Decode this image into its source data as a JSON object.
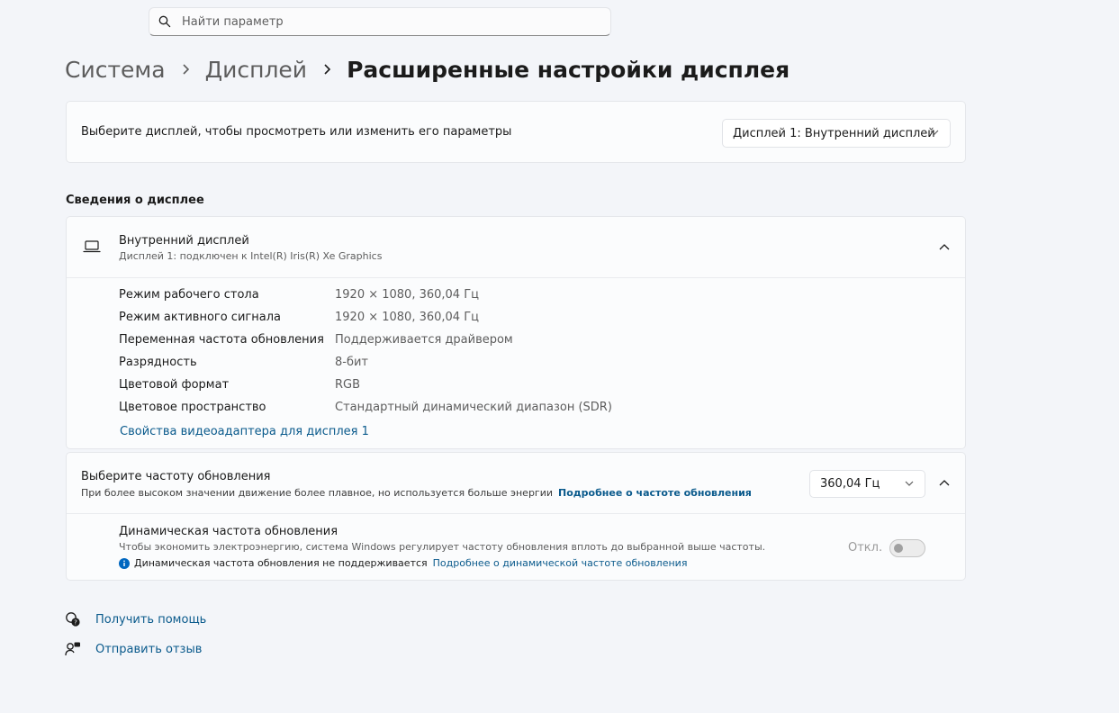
{
  "search": {
    "placeholder": "Найти параметр"
  },
  "breadcrumb": {
    "level1": "Система",
    "level2": "Дисплей",
    "current": "Расширенные настройки дисплея"
  },
  "display_select": {
    "label": "Выберите дисплей, чтобы просмотреть или изменить его параметры",
    "selected": "Дисплей 1: Внутренний дисплей"
  },
  "section_title": "Сведения о дисплее",
  "display_info": {
    "title": "Внутренний дисплей",
    "subtitle": "Дисплей 1: подключен к Intel(R) Iris(R) Xe Graphics",
    "properties": [
      {
        "label": "Режим рабочего стола",
        "value": "1920 × 1080, 360,04 Гц"
      },
      {
        "label": "Режим активного сигнала",
        "value": "1920 × 1080, 360,04 Гц"
      },
      {
        "label": "Переменная частота обновления",
        "value": "Поддерживается драйвером"
      },
      {
        "label": "Разрядность",
        "value": "8-бит"
      },
      {
        "label": "Цветовой формат",
        "value": "RGB"
      },
      {
        "label": "Цветовое пространство",
        "value": "Стандартный динамический диапазон (SDR)"
      }
    ],
    "adapter_link": "Свойства видеоадаптера для дисплея 1"
  },
  "refresh": {
    "title": "Выберите частоту обновления",
    "subtitle": "При более высоком значении движение более плавное, но используется больше энергии",
    "learn_more": "Подробнее о частоте обновления",
    "selected_rate": "360,04 Гц",
    "dynamic": {
      "title": "Динамическая частота обновления",
      "subtitle": "Чтобы экономить электроэнергию, система Windows регулирует частоту обновления вплоть до выбранной выше частоты.",
      "note": "Динамическая частота обновления не поддерживается",
      "note_link": "Подробнее о динамической частоте обновления",
      "toggle_state": "Откл."
    }
  },
  "footer": {
    "help": "Получить помощь",
    "feedback": "Отправить отзыв"
  },
  "colors": {
    "background": "#f3f5f9",
    "card": "#fbfcfd",
    "link": "#0a5a8c",
    "info_icon": "#0067c0"
  }
}
